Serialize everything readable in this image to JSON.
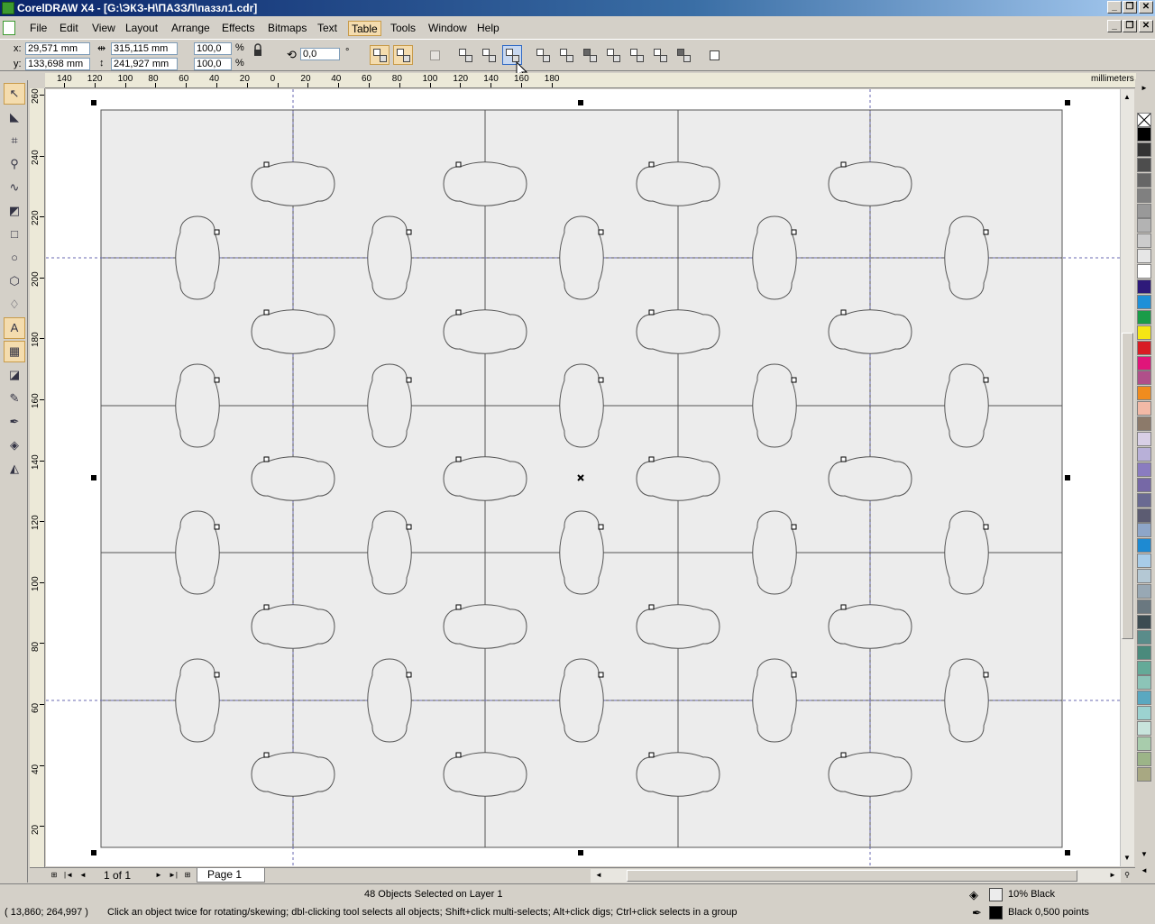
{
  "window": {
    "title": "CorelDRAW X4 - [G:\\ЭКЗ-Н\\ПАЗЗЛ\\паззл1.cdr]",
    "minimize": "_",
    "restore": "❐",
    "close": "✕"
  },
  "menu": {
    "items": [
      "File",
      "Edit",
      "View",
      "Layout",
      "Arrange",
      "Effects",
      "Bitmaps",
      "Text",
      "Table",
      "Tools",
      "Window",
      "Help"
    ],
    "active": "Table"
  },
  "property_bar": {
    "x_label": "x:",
    "y_label": "y:",
    "x_value": "29,571 mm",
    "y_value": "133,698 mm",
    "width_value": "315,115 mm",
    "height_value": "241,927 mm",
    "scale_x": "100,0",
    "scale_y": "100,0",
    "percent_sign": "%",
    "rotation": "0,0",
    "degree_sign": "°"
  },
  "toolbox": [
    "pick-tool",
    "shape-tool",
    "crop-tool",
    "zoom-tool",
    "freehand-tool",
    "smart-fill-tool",
    "rectangle-tool",
    "ellipse-tool",
    "polygon-tool",
    "basic-shapes-tool",
    "text-tool",
    "table-tool",
    "interactive-blend-tool",
    "eyedropper-tool",
    "outline-tool",
    "fill-tool",
    "interactive-fill-tool"
  ],
  "rulers": {
    "unit": "millimeters",
    "h_labels": [
      "140",
      "120",
      "100",
      "80",
      "60",
      "40",
      "20",
      "0",
      "20",
      "40",
      "60",
      "80",
      "100",
      "120",
      "140",
      "160",
      "180"
    ],
    "v_labels": [
      "260",
      "240",
      "220",
      "200",
      "180",
      "160",
      "140",
      "120",
      "100",
      "80",
      "60",
      "40",
      "20"
    ]
  },
  "navigation": {
    "page_count": "1 of 1",
    "page_tab": "Page 1"
  },
  "status": {
    "selection": "48 Objects Selected on Layer 1",
    "cursor_coords": "( 13,860; 264,997 )",
    "hint": "Click an object twice for rotating/skewing; dbl-clicking tool selects all objects; Shift+click multi-selects; Alt+click digs; Ctrl+click selects in a group",
    "fill_label": "10% Black",
    "outline_label": "Black  0,500 points",
    "fill_color": "#ececec",
    "outline_color": "#000000"
  },
  "palette_colors": [
    "#000000",
    "#333333",
    "#4d4d4d",
    "#666666",
    "#808080",
    "#999999",
    "#b3b3b3",
    "#cccccc",
    "#e6e6e6",
    "#ffffff",
    "#2e1a7a",
    "#1e90d8",
    "#1a9c48",
    "#f5e614",
    "#d81c24",
    "#e0157a",
    "#b04f8a",
    "#f08c1e",
    "#f2b9a6",
    "#8c7a6a",
    "#d8cfe6",
    "#b8b0d8",
    "#8a7cc0",
    "#7668a6",
    "#6a6a92",
    "#5c5c72",
    "#8ea6c8",
    "#1e8ad2",
    "#a8cce8",
    "#b4c8d4",
    "#98a8b4",
    "#6a7880",
    "#3c4c52",
    "#5a8c8a",
    "#4a8a7c",
    "#64aa98",
    "#8cc4b8",
    "#5aa8c0",
    "#9cd2d0",
    "#c8e4dc",
    "#a8ccac",
    "#9cb488",
    "#a8a882"
  ],
  "colors": {
    "accent": "#f4dcae",
    "title_bar": "#0a246a",
    "page_fill": "#ececec",
    "guide": "#6a6ab0"
  }
}
